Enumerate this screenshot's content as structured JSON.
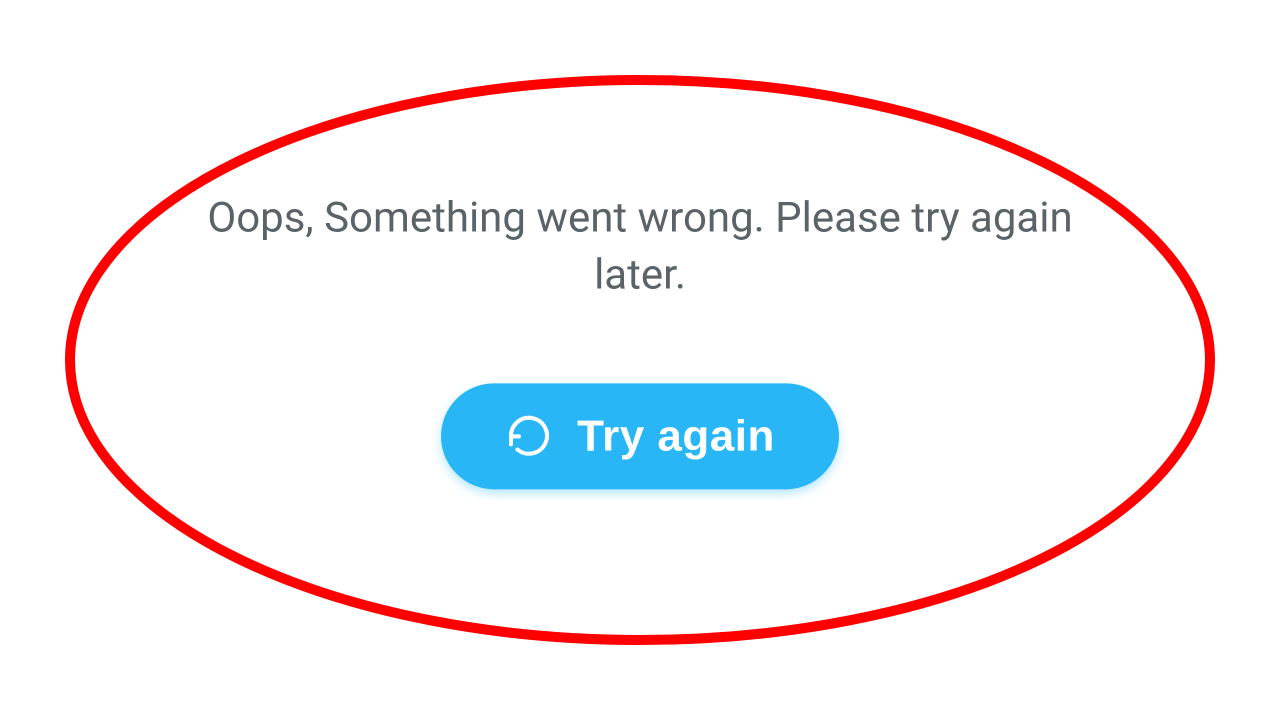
{
  "error": {
    "message": "Oops, Something went wrong. Please try again later.",
    "retry_label": "Try again"
  },
  "colors": {
    "accent": "#29b6f6",
    "annotation": "#ff0000",
    "text_muted": "#5a6368"
  }
}
